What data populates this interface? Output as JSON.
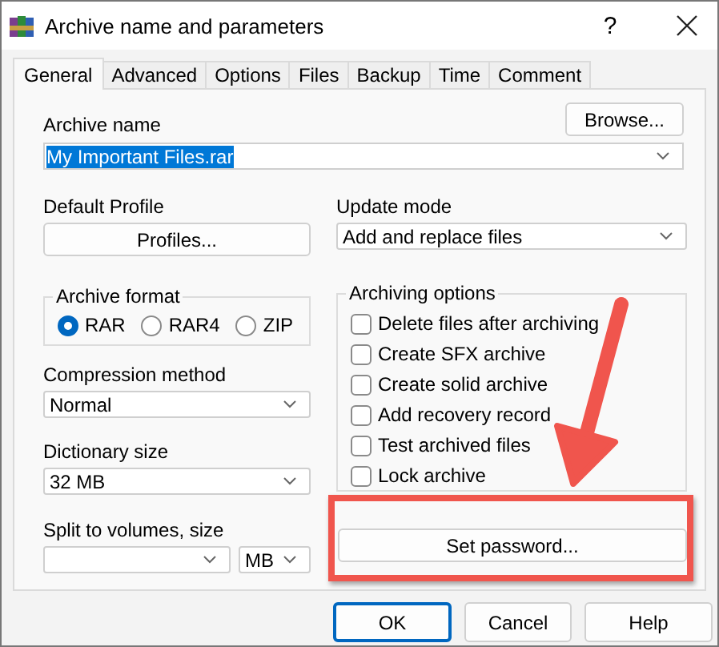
{
  "window": {
    "title": "Archive name and parameters",
    "help_button": "?"
  },
  "tabs": [
    {
      "label": "General",
      "selected": true
    },
    {
      "label": "Advanced",
      "selected": false
    },
    {
      "label": "Options",
      "selected": false
    },
    {
      "label": "Files",
      "selected": false
    },
    {
      "label": "Backup",
      "selected": false
    },
    {
      "label": "Time",
      "selected": false
    },
    {
      "label": "Comment",
      "selected": false
    }
  ],
  "archive_name": {
    "label": "Archive name",
    "value": "My Important Files.rar",
    "text_selected": true,
    "browse_button": "Browse..."
  },
  "default_profile": {
    "label": "Default Profile",
    "button": "Profiles..."
  },
  "update_mode": {
    "label": "Update mode",
    "value": "Add and replace files"
  },
  "archive_format": {
    "label": "Archive format",
    "options": [
      {
        "label": "RAR",
        "selected": true
      },
      {
        "label": "RAR4",
        "selected": false
      },
      {
        "label": "ZIP",
        "selected": false
      }
    ]
  },
  "archiving_options": {
    "label": "Archiving options",
    "items": [
      {
        "label": "Delete files after archiving",
        "checked": false
      },
      {
        "label": "Create SFX archive",
        "checked": false
      },
      {
        "label": "Create solid archive",
        "checked": false
      },
      {
        "label": "Add recovery record",
        "checked": false
      },
      {
        "label": "Test archived files",
        "checked": false
      },
      {
        "label": "Lock archive",
        "checked": false
      }
    ]
  },
  "compression_method": {
    "label": "Compression method",
    "value": "Normal"
  },
  "dictionary_size": {
    "label": "Dictionary size",
    "value": "32 MB"
  },
  "split_to_volumes": {
    "label": "Split to volumes, size",
    "unit": "MB"
  },
  "set_password_button": "Set password...",
  "buttons": [
    {
      "label": "OK",
      "default": true
    },
    {
      "label": "Cancel",
      "default": false
    },
    {
      "label": "Help",
      "default": false
    }
  ]
}
